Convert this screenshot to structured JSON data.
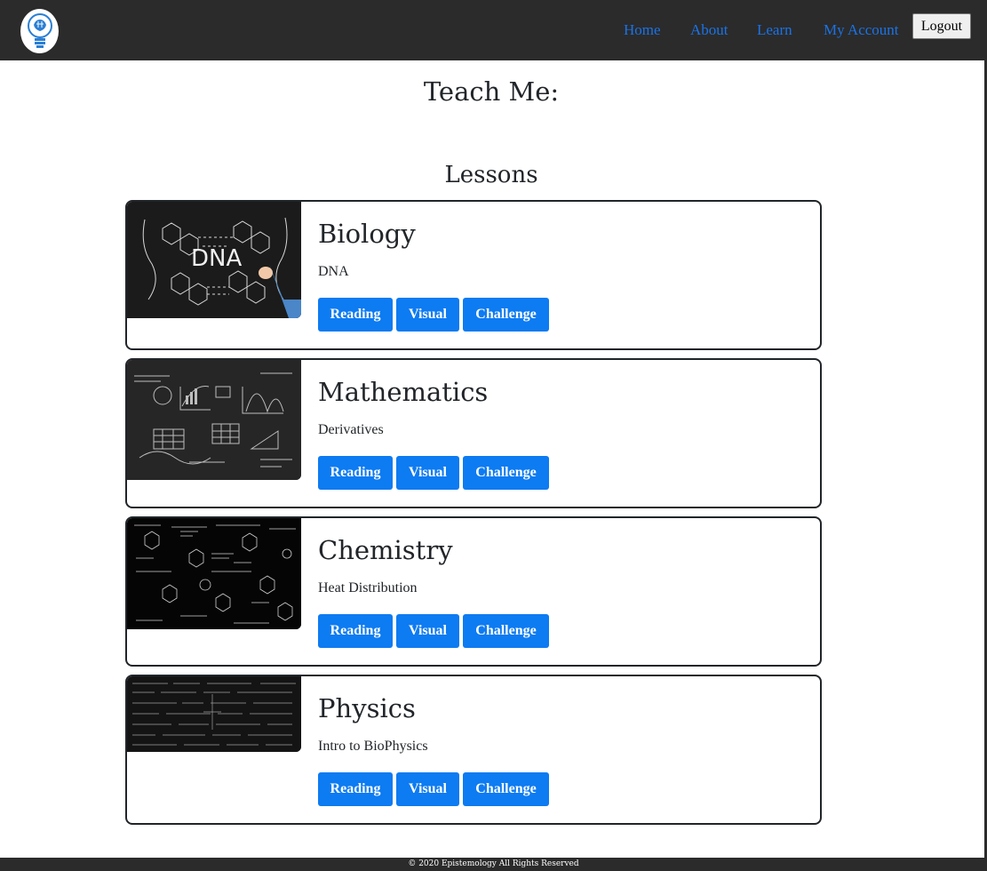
{
  "nav": {
    "links": [
      "Home",
      "About",
      "Learn",
      "My Account"
    ],
    "logout_label": "Logout"
  },
  "page": {
    "title": "Teach Me:",
    "section_title": "Lessons"
  },
  "lessons": [
    {
      "subject": "Biology",
      "topic": "DNA",
      "buttons": [
        "Reading",
        "Visual",
        "Challenge"
      ],
      "image_text": "DNA"
    },
    {
      "subject": "Mathematics",
      "topic": "Derivatives",
      "buttons": [
        "Reading",
        "Visual",
        "Challenge"
      ]
    },
    {
      "subject": "Chemistry",
      "topic": "Heat Distribution",
      "buttons": [
        "Reading",
        "Visual",
        "Challenge"
      ]
    },
    {
      "subject": "Physics",
      "topic": "Intro to BioPhysics",
      "buttons": [
        "Reading",
        "Visual",
        "Challenge"
      ]
    }
  ],
  "footer": {
    "text": "© 2020 Epistemology All Rights Reserved"
  },
  "colors": {
    "nav_bg": "#2b2b2b",
    "link": "#1a73e8",
    "button": "#0d7bf2",
    "card_border": "#212529"
  }
}
